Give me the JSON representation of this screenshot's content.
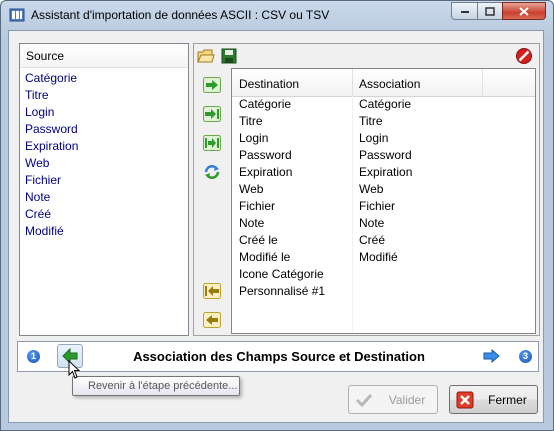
{
  "window": {
    "title": "Assistant d'importation de données ASCII : CSV ou TSV"
  },
  "source": {
    "header": "Source",
    "items": [
      "Catégorie",
      "Titre",
      "Login",
      "Password",
      "Expiration",
      "Web",
      "Fichier",
      "Note",
      "Créé",
      "Modifié"
    ]
  },
  "mapping": {
    "headers": {
      "destination": "Destination",
      "association": "Association"
    },
    "rows": [
      {
        "destination": "Catégorie",
        "association": "Catégorie"
      },
      {
        "destination": "Titre",
        "association": "Titre"
      },
      {
        "destination": "Login",
        "association": "Login"
      },
      {
        "destination": "Password",
        "association": "Password"
      },
      {
        "destination": "Expiration",
        "association": "Expiration"
      },
      {
        "destination": "Web",
        "association": "Web"
      },
      {
        "destination": "Fichier",
        "association": "Fichier"
      },
      {
        "destination": "Note",
        "association": "Note"
      },
      {
        "destination": "Créé le",
        "association": "Créé"
      },
      {
        "destination": "Modifié le",
        "association": "Modifié"
      },
      {
        "destination": "Icone Catégorie",
        "association": ""
      },
      {
        "destination": "Personnalisé #1",
        "association": ""
      }
    ]
  },
  "wizard": {
    "current_step": "1",
    "next_step": "3",
    "step_title": "Association des Champs Source et Destination",
    "back_tooltip": "Revenir à l'étape précédente..."
  },
  "buttons": {
    "validate_label": "Valider",
    "close_label": "Fermer"
  },
  "colors": {
    "source_text": "#000080",
    "accent_blue": "#1450b4",
    "nav_green": "#2e9a2e",
    "delete_red": "#d42020"
  },
  "icons": {
    "open": "open-folder-icon",
    "save": "save-icon",
    "delete": "no-entry-icon",
    "add": "arrow-right-green-icon",
    "insert": "arrow-right-bar-icon",
    "map_all": "arrow-bar-both-icon",
    "swap": "refresh-icon",
    "remove": "arrow-left-bar-icon",
    "remove_all": "arrow-left-yellow-icon"
  }
}
